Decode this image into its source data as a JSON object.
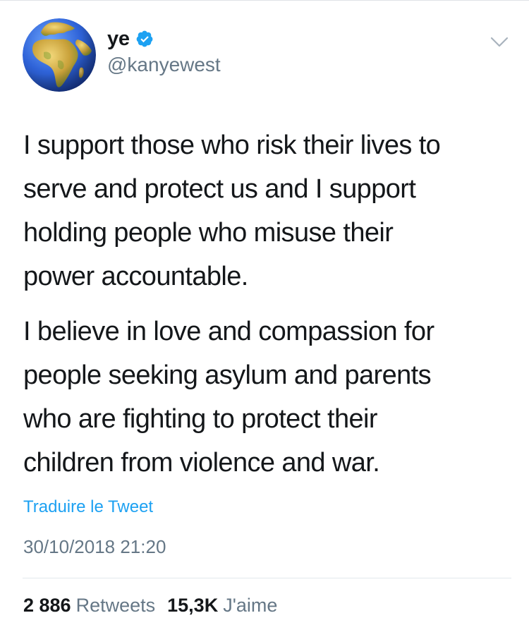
{
  "tweet": {
    "author": {
      "display_name": "ye",
      "handle": "@kanyewest",
      "verified": true,
      "avatar_icon": "globe-africa-icon"
    },
    "menu_icon": "chevron-down-icon",
    "paragraphs": [
      {
        "lines": [
          "I support those who risk their lives to",
          "serve and protect us and I support",
          "holding people who misuse their",
          "power accountable."
        ]
      },
      {
        "lines": [
          "I believe in love and compassion for",
          "people seeking asylum and parents",
          "who are fighting to protect their",
          "children from violence and war."
        ]
      }
    ],
    "translate_label": "Traduire le Tweet",
    "timestamp": "30/10/2018 21:20",
    "stats": {
      "retweets_count": "2 886",
      "retweets_label": "Retweets",
      "likes_count": "15,3K",
      "likes_label": "J'aime"
    }
  },
  "colors": {
    "link": "#1da1f2",
    "secondary_text": "#657786",
    "primary_text": "#14171a",
    "verified_badge": "#1da1f2"
  }
}
